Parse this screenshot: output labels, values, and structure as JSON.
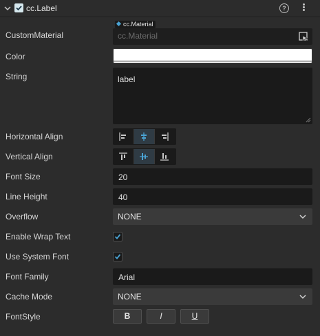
{
  "component": {
    "title": "cc.Label",
    "enabled": true
  },
  "properties": {
    "custom_material": {
      "label": "CustomMaterial",
      "type_tag": "cc.Material",
      "placeholder": "cc.Material"
    },
    "color": {
      "label": "Color",
      "value": "#ffffff"
    },
    "string": {
      "label": "String",
      "value": "label"
    },
    "horizontal_align": {
      "label": "Horizontal Align",
      "options": [
        "left",
        "center",
        "right"
      ],
      "selected": "center"
    },
    "vertical_align": {
      "label": "Vertical Align",
      "options": [
        "top",
        "center",
        "bottom"
      ],
      "selected": "center"
    },
    "font_size": {
      "label": "Font Size",
      "value": "20"
    },
    "line_height": {
      "label": "Line Height",
      "value": "40"
    },
    "overflow": {
      "label": "Overflow",
      "value": "NONE"
    },
    "enable_wrap_text": {
      "label": "Enable Wrap Text",
      "checked": true
    },
    "use_system_font": {
      "label": "Use System Font",
      "checked": true
    },
    "font_family": {
      "label": "Font Family",
      "value": "Arial"
    },
    "cache_mode": {
      "label": "Cache Mode",
      "value": "NONE"
    },
    "font_style": {
      "label": "FontStyle",
      "bold": "B",
      "italic": "I",
      "underline": "U"
    }
  },
  "icons": {
    "collapse": "chevron-down-icon",
    "help": "help-circle-icon",
    "more": "more-vertical-icon",
    "asset_picker": "asset-picker-icon"
  },
  "colors": {
    "accent": "#4aa3d4",
    "panel": "#2c2c2c",
    "field": "#1a1a1a"
  }
}
